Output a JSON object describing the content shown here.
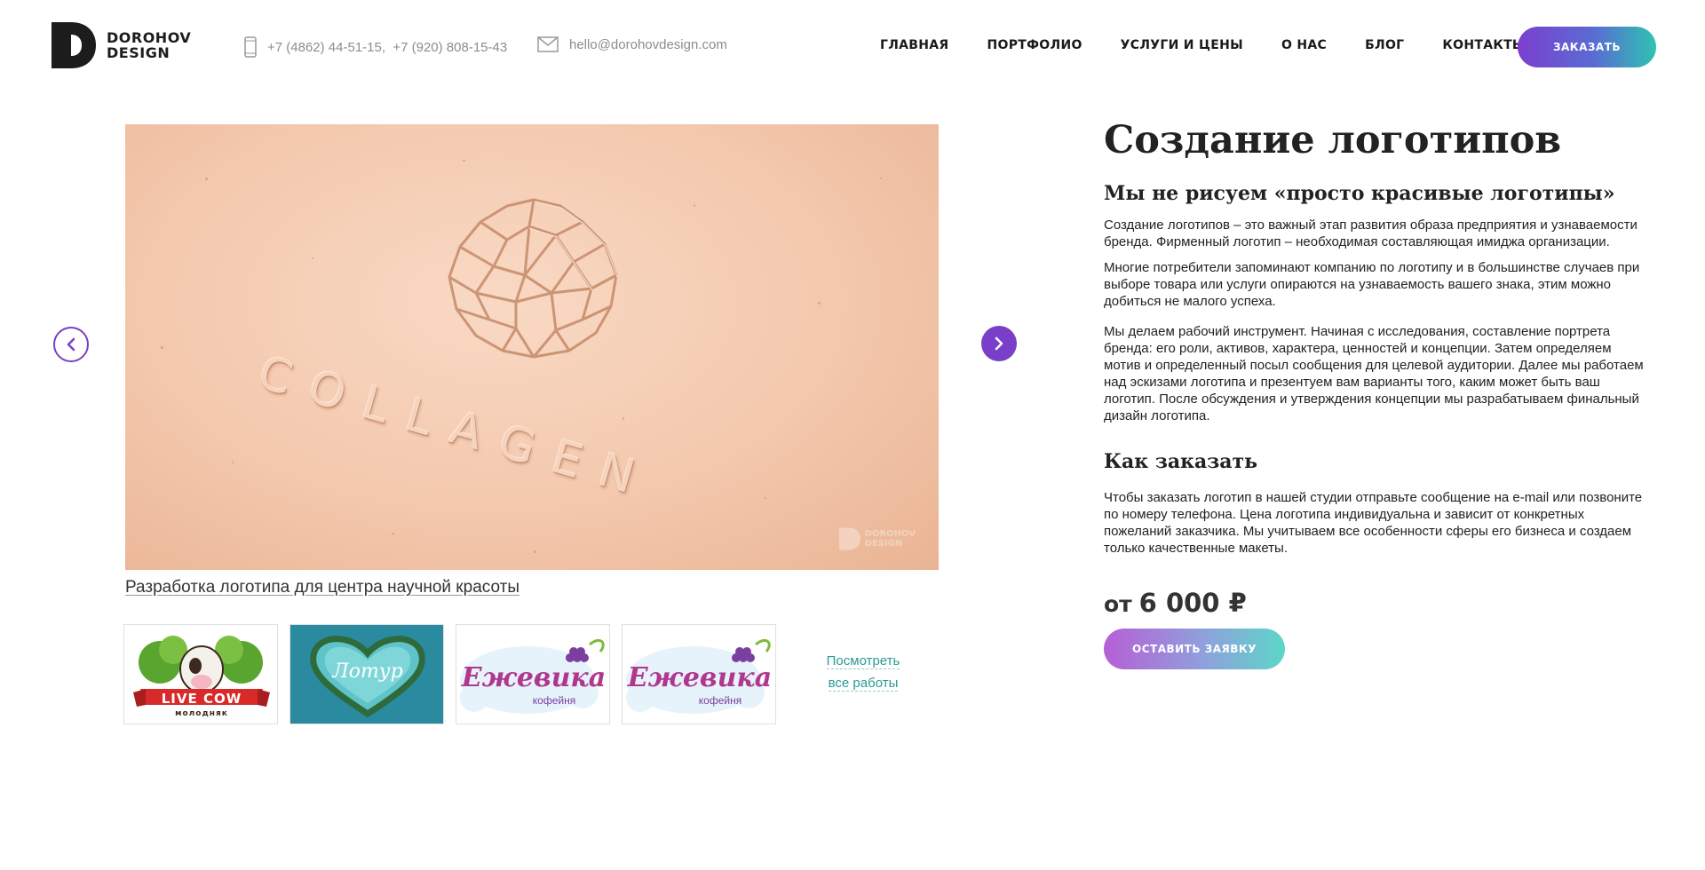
{
  "brand": {
    "line1": "DOROHOV",
    "line2": "DESIGN"
  },
  "header": {
    "phone": "+7 (4862) 44-51-15,  +7 (920) 808-15-43",
    "email": "hello@dorohovdesign.com",
    "order_label": "ЗАКАЗАТЬ"
  },
  "nav": [
    "ГЛАВНАЯ",
    "ПОРТФОЛИО",
    "УСЛУГИ И ЦЕНЫ",
    "О НАС",
    "БЛОГ",
    "КОНТАКТЫ"
  ],
  "slider": {
    "image_text": "COLLAGEN",
    "watermark": {
      "line1": "DOROHOV",
      "line2": "DESIGN"
    },
    "caption": "Разработка логотипа для центра научной красоты",
    "thumbnails": [
      {
        "line1": "LIVE COW",
        "line2": "молодняк"
      },
      {
        "line1": "Лотур"
      },
      {
        "line1": "Ежевика",
        "line2": "кофейня"
      },
      {
        "line1": "Ежевика",
        "line2": "кофейня"
      }
    ],
    "view_all": {
      "line1": "Посмотреть",
      "line2": "все работы"
    }
  },
  "content": {
    "title": "Создание логотипов",
    "subtitle": "Мы не рисуем «просто красивые логотипы»",
    "paragraphs": [
      "Создание логотипов – это важный этап развития образа предприятия и узнаваемости бренда. Фирменный логотип – необходимая составляющая имиджа организации.",
      "Многие потребители запоминают компанию по логотипу и в  большинстве случаев при выборе товара или услуги опираются на узнаваемость вашего знака, этим можно добиться не малого успеха.",
      "Мы делаем рабочий инструмент. Начиная с исследования, составление портрета бренда: его роли, активов, характера, ценностей и концепции. Затем определяем мотив и определенный посыл сообщения для целевой аудитории. Далее мы работаем над эскизами логотипа и презентуем вам варианты того, каким может быть ваш логотип. После обсуждения и утверждения концепции мы разрабатываем финальный дизайн логотипа."
    ],
    "how_title": "Как заказать",
    "how_text": "Чтобы заказать логотип в нашей студии отправьте сообщение на e-mail или позвоните по номеру телефона. Цена логотипа индивидуальна и зависит от конкретных пожеланий заказчика. Мы учитываем все особенности сферы его бизнеса и создаем только качественные макеты.",
    "price_prefix": "от",
    "price": "6 000 ₽",
    "request_label": "ОСТАВИТЬ ЗАЯВКУ"
  },
  "colors": {
    "accent": "#7a3fc9",
    "teal": "#2ec3b2",
    "link": "#2a9a98"
  }
}
